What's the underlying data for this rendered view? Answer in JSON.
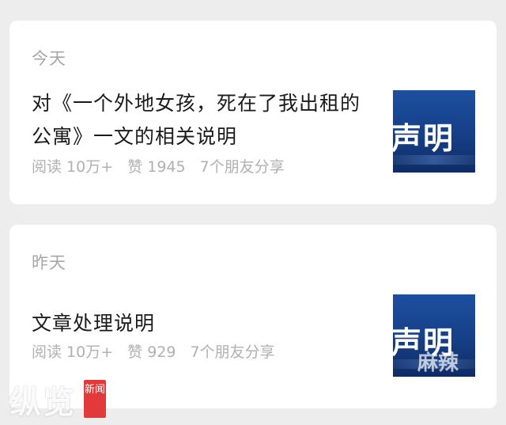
{
  "sections": [
    {
      "day": "今天",
      "article": {
        "title": "对《一个外地女孩，死在了我出租的公寓》一文的相关说明",
        "reads": "阅读 10万+",
        "likes": "赞 1945",
        "shares": "7个朋友分享",
        "thumbnail_text": "声明"
      }
    },
    {
      "day": "昨天",
      "article": {
        "title": "文章处理说明",
        "reads": "阅读 10万+",
        "likes": "赞 929",
        "shares": "7个朋友分享",
        "thumbnail_text": "声明"
      }
    }
  ],
  "watermark": {
    "logo_text": "纵览",
    "badge_text": "新闻",
    "thumb_overlay": "麻辣"
  },
  "colors": {
    "background": "#ededed",
    "card": "#ffffff",
    "title": "#1b1b1b",
    "meta": "#b0b0b0",
    "thumb_blue": "#1d4fa0",
    "badge_red": "#e23a3a"
  }
}
